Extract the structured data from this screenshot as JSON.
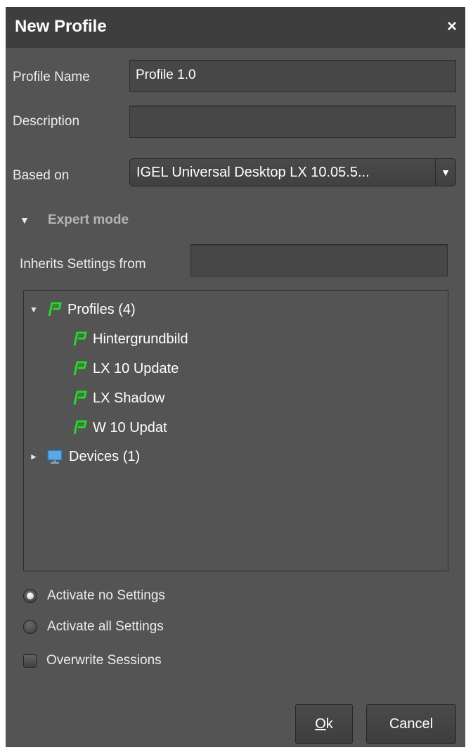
{
  "dialog": {
    "title": "New Profile",
    "close_glyph": "×"
  },
  "form": {
    "profile_name_label": "Profile Name",
    "profile_name_value": "Profile 1.0",
    "description_label": "Description",
    "description_value": "",
    "based_on_label": "Based on",
    "based_on_value": "IGEL Universal Desktop LX 10.05.5...",
    "expert_mode_label": "Expert mode",
    "inherits_label": "Inherits Settings from",
    "inherits_value": ""
  },
  "tree": {
    "root": {
      "label": "Profiles (4)",
      "icon": "profile-icon",
      "expanded": true
    },
    "children": [
      {
        "label": "Hintergrundbild",
        "icon": "profile-icon"
      },
      {
        "label": "LX 10 Update",
        "icon": "profile-icon"
      },
      {
        "label": "LX Shadow",
        "icon": "profile-icon"
      },
      {
        "label": "W 10 Updat",
        "icon": "profile-icon"
      }
    ],
    "devices": {
      "label": "Devices (1)",
      "icon": "monitor-icon",
      "expanded": false
    }
  },
  "options": {
    "activate_none": "Activate no Settings",
    "activate_all": "Activate all Settings",
    "overwrite_sessions": "Overwrite Sessions",
    "selected": "activate_none",
    "overwrite_checked": false
  },
  "buttons": {
    "ok_mnemonic": "O",
    "ok_rest": "k",
    "cancel": "Cancel"
  },
  "colors": {
    "background": "#545454",
    "titlebar": "#3e3e3e",
    "profile_icon": "#2bd52b",
    "monitor_icon": "#5aa9e6"
  }
}
